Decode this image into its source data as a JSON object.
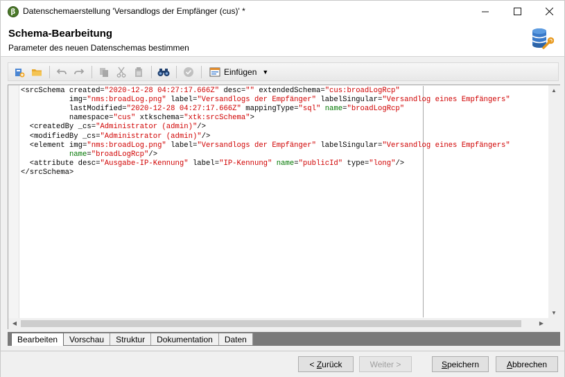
{
  "window": {
    "title": "Datenschemaerstellung 'Versandlogs der Empfänger (cus)' *",
    "app_icon_glyph": "β"
  },
  "header": {
    "title": "Schema-Bearbeitung",
    "subtitle": "Parameter des neuen Datenschemas bestimmen",
    "icon": "database-wrench-icon"
  },
  "toolbar": {
    "items": [
      "new-schema-icon",
      "open-folder-icon",
      "undo-icon",
      "redo-icon",
      "copy-icon",
      "cut-icon",
      "paste-icon",
      "find-binoculars-icon",
      "validate-check-icon",
      "insert-icon"
    ],
    "insert_label": "Einfügen"
  },
  "editor": {
    "lines": [
      [
        {
          "c": "t",
          "s": "<srcSchema created="
        },
        {
          "c": "v",
          "s": "\"2020-12-28 04:27:17.666Z\""
        },
        {
          "c": "t",
          "s": " desc="
        },
        {
          "c": "v",
          "s": "\"\""
        },
        {
          "c": "t",
          "s": " extendedSchema="
        },
        {
          "c": "v",
          "s": "\"cus:broadLogRcp\""
        }
      ],
      [
        {
          "c": "t",
          "s": "           img="
        },
        {
          "c": "v",
          "s": "\"nms:broadLog.png\""
        },
        {
          "c": "t",
          "s": " label="
        },
        {
          "c": "v",
          "s": "\"Versandlogs der Empfänger\""
        },
        {
          "c": "t",
          "s": " labelSingular="
        },
        {
          "c": "v",
          "s": "\"Versandlog eines Empfängers\""
        }
      ],
      [
        {
          "c": "t",
          "s": "           lastModified="
        },
        {
          "c": "v",
          "s": "\"2020-12-28 04:27:17.666Z\""
        },
        {
          "c": "t",
          "s": " mappingType="
        },
        {
          "c": "v",
          "s": "\"sql\""
        },
        {
          "c": "t",
          "s": " "
        },
        {
          "c": "g",
          "s": "name"
        },
        {
          "c": "t",
          "s": "="
        },
        {
          "c": "v",
          "s": "\"broadLogRcp\""
        }
      ],
      [
        {
          "c": "t",
          "s": "           namespace="
        },
        {
          "c": "v",
          "s": "\"cus\""
        },
        {
          "c": "t",
          "s": " xtkschema="
        },
        {
          "c": "v",
          "s": "\"xtk:srcSchema\""
        },
        {
          "c": "t",
          "s": ">"
        }
      ],
      [
        {
          "c": "t",
          "s": "  <createdBy _cs="
        },
        {
          "c": "v",
          "s": "\"Administrator (admin)\""
        },
        {
          "c": "t",
          "s": "/>"
        }
      ],
      [
        {
          "c": "t",
          "s": "  <modifiedBy _cs="
        },
        {
          "c": "v",
          "s": "\"Administrator (admin)\""
        },
        {
          "c": "t",
          "s": "/>"
        }
      ],
      [
        {
          "c": "t",
          "s": "  <element img="
        },
        {
          "c": "v",
          "s": "\"nms:broadLog.png\""
        },
        {
          "c": "t",
          "s": " label="
        },
        {
          "c": "v",
          "s": "\"Versandlogs der Empfänger\""
        },
        {
          "c": "t",
          "s": " labelSingular="
        },
        {
          "c": "v",
          "s": "\"Versandlog eines Empfängers\""
        }
      ],
      [
        {
          "c": "t",
          "s": "           "
        },
        {
          "c": "g",
          "s": "name"
        },
        {
          "c": "t",
          "s": "="
        },
        {
          "c": "v",
          "s": "\"broadLogRcp\""
        },
        {
          "c": "t",
          "s": "/>"
        }
      ],
      [
        {
          "c": "t",
          "s": "  <attribute desc="
        },
        {
          "c": "v",
          "s": "\"Ausgabe-IP-Kennung\""
        },
        {
          "c": "t",
          "s": " label="
        },
        {
          "c": "v",
          "s": "\"IP-Kennung\""
        },
        {
          "c": "t",
          "s": " "
        },
        {
          "c": "g",
          "s": "name"
        },
        {
          "c": "t",
          "s": "="
        },
        {
          "c": "v",
          "s": "\"publicId\""
        },
        {
          "c": "t",
          "s": " type="
        },
        {
          "c": "v",
          "s": "\"long\""
        },
        {
          "c": "t",
          "s": "/>"
        }
      ],
      [
        {
          "c": "t",
          "s": "</srcSchema>"
        }
      ]
    ]
  },
  "tabs": [
    {
      "label": "Bearbeiten",
      "active": true
    },
    {
      "label": "Vorschau",
      "active": false
    },
    {
      "label": "Struktur",
      "active": false
    },
    {
      "label": "Dokumentation",
      "active": false
    },
    {
      "label": "Daten",
      "active": false
    }
  ],
  "buttons": {
    "back_label": "< Zurück",
    "back_mnemonic": "Z",
    "next_label": "Weiter >",
    "save_label": "Speichern",
    "save_mnemonic": "S",
    "cancel_label": "Abbrechen",
    "cancel_mnemonic": "A"
  },
  "colors": {
    "tag_text": "#000000",
    "attribute_value": "#d00000",
    "name_attribute": "#007700",
    "tab_strip": "#7a7a7a"
  }
}
